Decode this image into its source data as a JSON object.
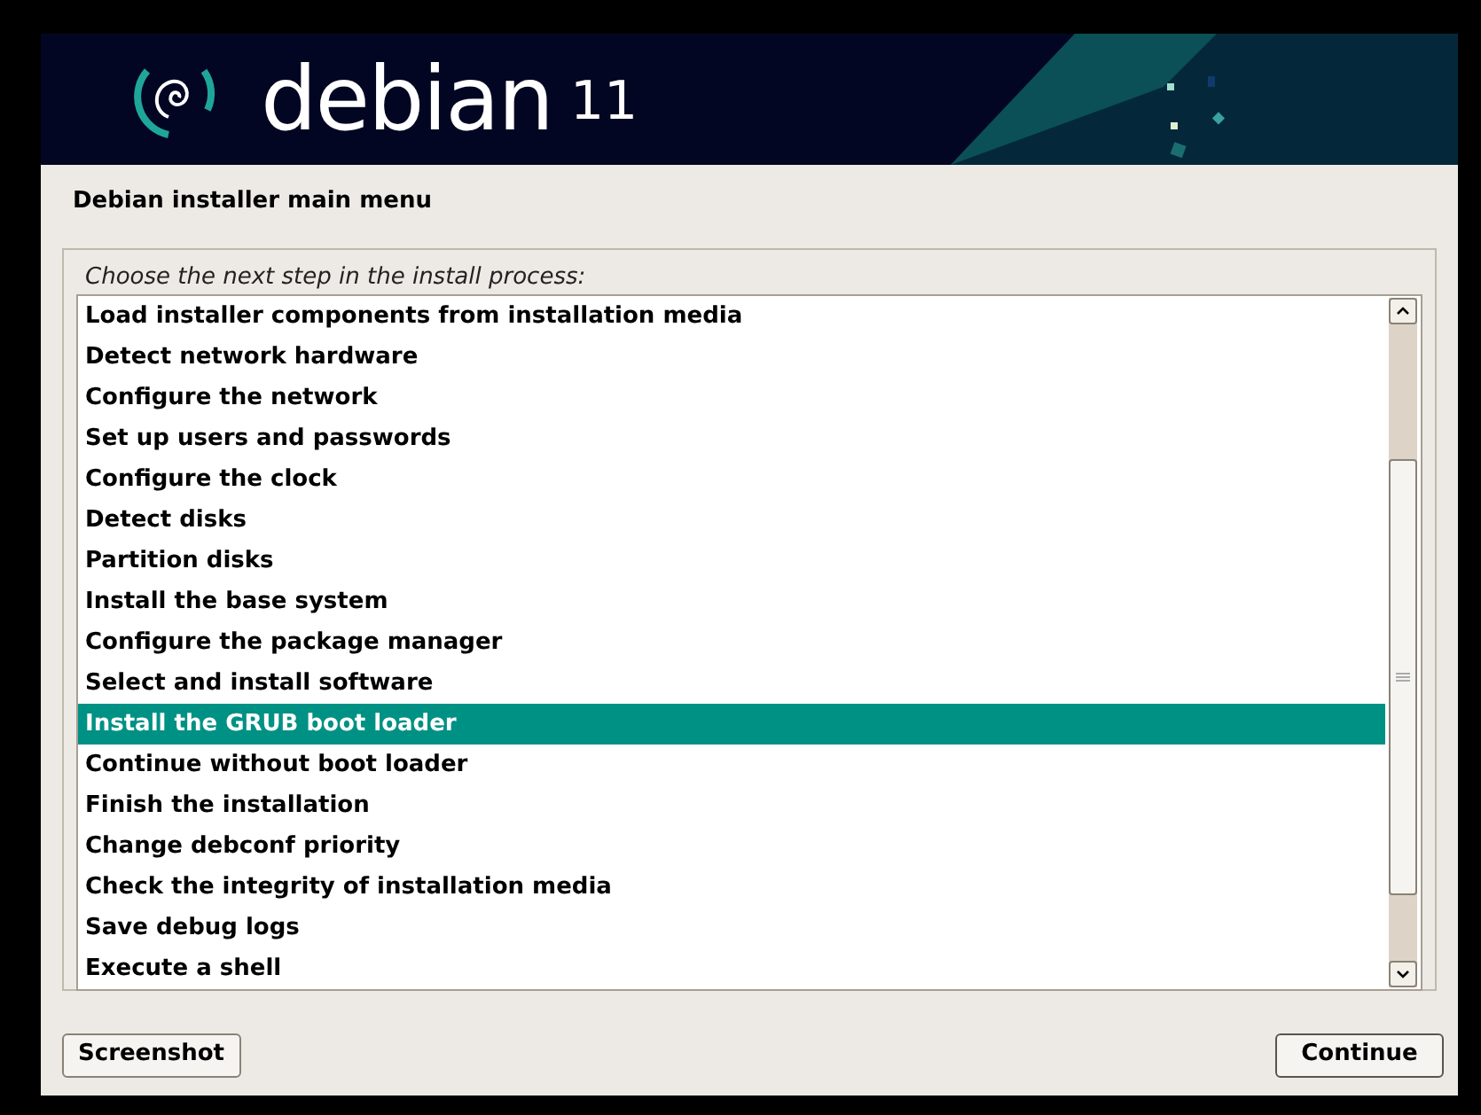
{
  "banner": {
    "logo_text": "debian",
    "version": "11"
  },
  "window": {
    "title": "Debian installer main menu"
  },
  "prompt": "Choose the next step in the install process:",
  "menu_items": [
    {
      "label": "Load installer components from installation media",
      "selected": false
    },
    {
      "label": "Detect network hardware",
      "selected": false
    },
    {
      "label": "Configure the network",
      "selected": false
    },
    {
      "label": "Set up users and passwords",
      "selected": false
    },
    {
      "label": "Configure the clock",
      "selected": false
    },
    {
      "label": "Detect disks",
      "selected": false
    },
    {
      "label": "Partition disks",
      "selected": false
    },
    {
      "label": "Install the base system",
      "selected": false
    },
    {
      "label": "Configure the package manager",
      "selected": false
    },
    {
      "label": "Select and install software",
      "selected": false
    },
    {
      "label": "Install the GRUB boot loader",
      "selected": true
    },
    {
      "label": "Continue without boot loader",
      "selected": false
    },
    {
      "label": "Finish the installation",
      "selected": false
    },
    {
      "label": "Change debconf priority",
      "selected": false
    },
    {
      "label": "Check the integrity of installation media",
      "selected": false
    },
    {
      "label": "Save debug logs",
      "selected": false
    },
    {
      "label": "Execute a shell",
      "selected": false
    }
  ],
  "buttons": {
    "left": "Screenshot",
    "right": "Continue"
  }
}
